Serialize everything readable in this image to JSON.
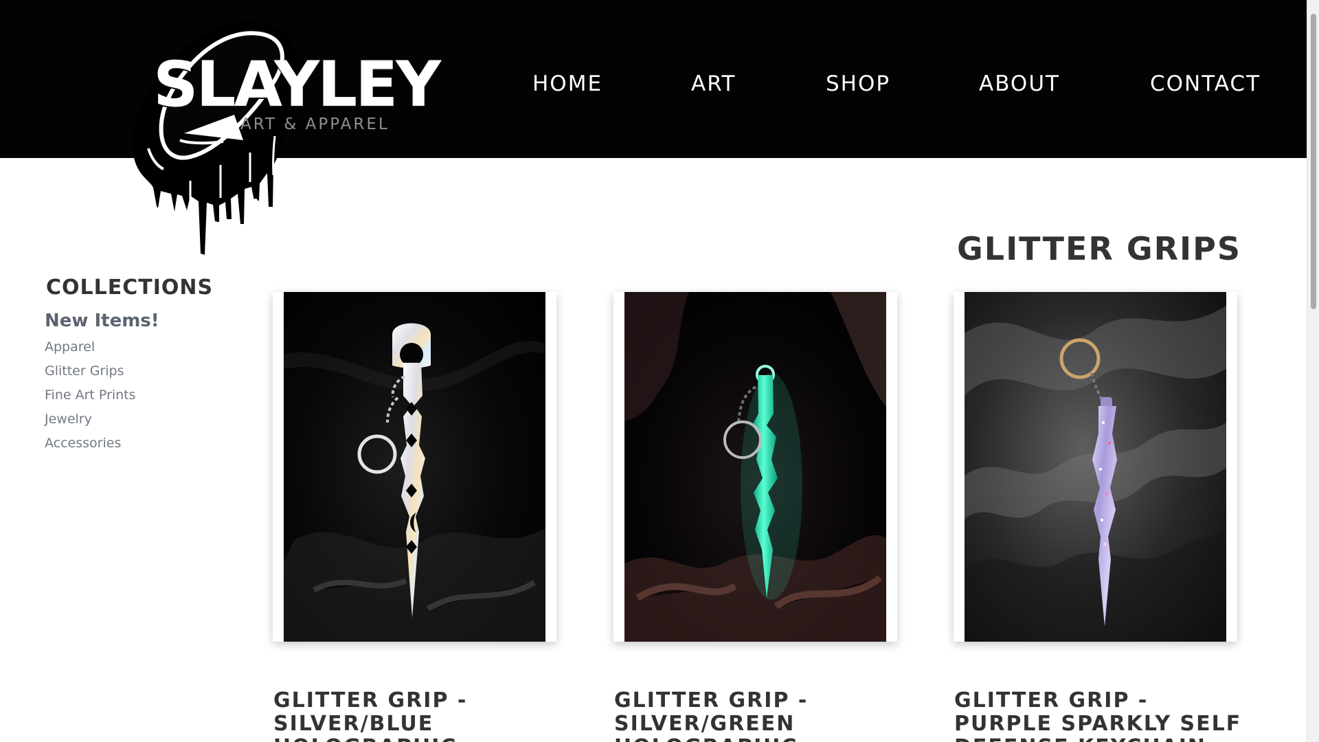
{
  "site": {
    "logo_text": "SLAYLEY",
    "logo_tagline": "ART & APPAREL",
    "logo_icon": "dripping-clock-icon"
  },
  "nav": {
    "items": [
      {
        "label": "HOME"
      },
      {
        "label": "ART"
      },
      {
        "label": "SHOP"
      },
      {
        "label": "ABOUT"
      },
      {
        "label": "CONTACT"
      }
    ]
  },
  "sidebar": {
    "title": "COLLECTIONS",
    "featured": "New Items!",
    "items": [
      {
        "label": "Apparel"
      },
      {
        "label": "Glitter Grips"
      },
      {
        "label": "Fine Art Prints"
      },
      {
        "label": "Jewelry"
      },
      {
        "label": "Accessories"
      }
    ]
  },
  "main": {
    "title": "GLITTER GRIPS",
    "products": [
      {
        "title": "GLITTER GRIP - SILVER/BLUE HOLOGRAPHIC",
        "image_icon": "silver-holographic-glitter-grip-photo"
      },
      {
        "title": "GLITTER GRIP - SILVER/GREEN HOLOGRAPHIC",
        "image_icon": "green-holographic-glitter-grip-photo"
      },
      {
        "title": "GLITTER GRIP - PURPLE SPARKLY SELF DEFENSE KEYCHAIN",
        "image_icon": "purple-sparkly-glitter-grip-photo"
      }
    ]
  },
  "colors": {
    "header_background": "#030303",
    "page_background": "#ffffff",
    "heading_text": "#333333",
    "sidebar_link": "#727882",
    "green_grip": "#32dfb5",
    "purple_grip": "#b8a7e2"
  }
}
